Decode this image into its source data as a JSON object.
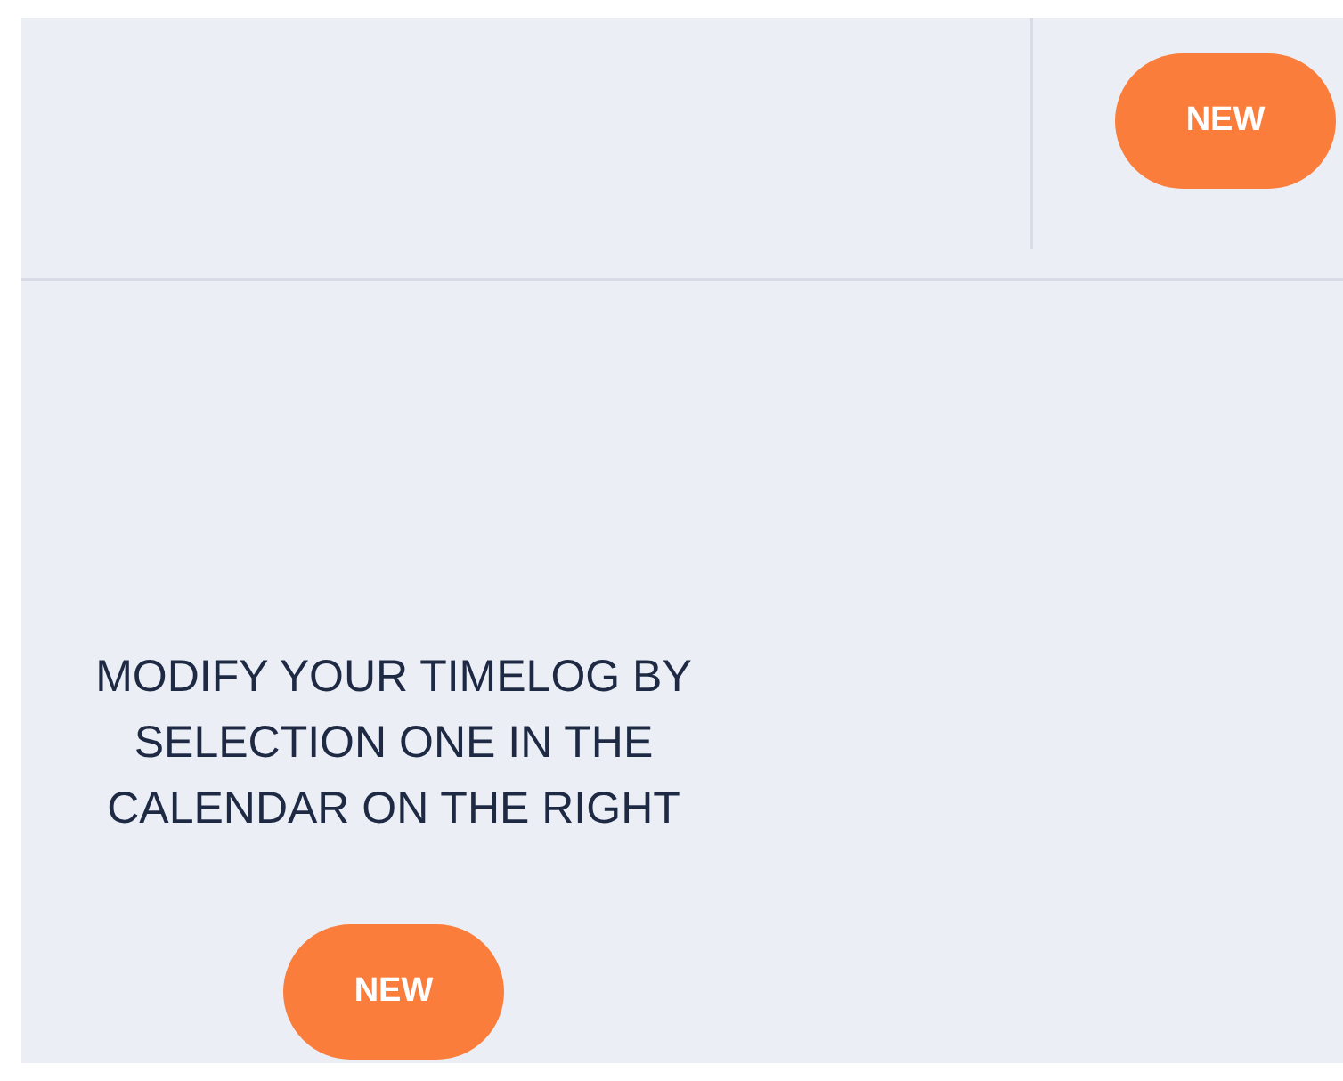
{
  "header": {
    "new_button": "NEW"
  },
  "empty_state": {
    "message": "MODIFY YOUR TIMELOG BY SELECTION ONE IN THE CALENDAR ON THE RIGHT",
    "new_button": "NEW"
  }
}
